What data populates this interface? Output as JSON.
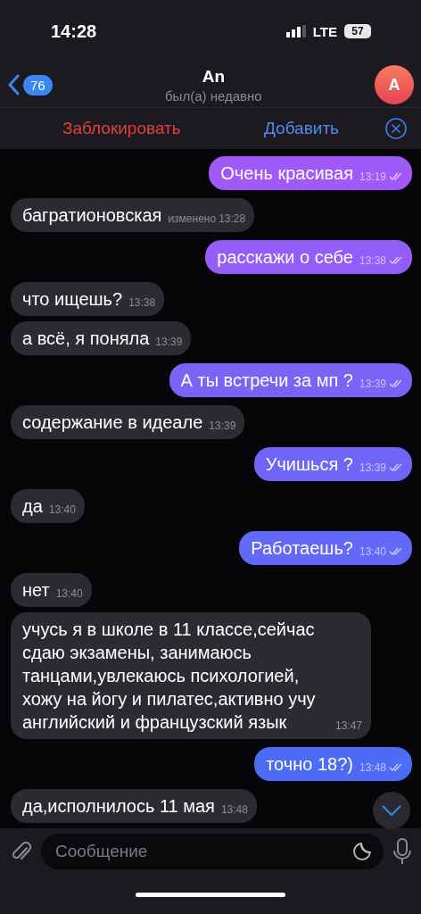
{
  "status_bar": {
    "time": "14:28",
    "network": "LTE",
    "battery": "57"
  },
  "header": {
    "back_count": "76",
    "title": "An",
    "subtitle": "был(а) недавно",
    "avatar": "A"
  },
  "action_bar": {
    "block": "Заблокировать",
    "add": "Добавить"
  },
  "messages": [
    {
      "kind": "outgoing",
      "text": "Очень красивая",
      "time": "13:19",
      "read": true
    },
    {
      "kind": "incoming",
      "text": "багратионовская",
      "time": "13:28",
      "edited": "изменено"
    },
    {
      "kind": "outgoing",
      "text": "расскажи о себе",
      "time": "13:38",
      "read": true
    },
    {
      "kind": "incoming",
      "text": "что ищешь?",
      "time": "13:38"
    },
    {
      "kind": "incoming",
      "text": "а всё, я поняла",
      "time": "13:39"
    },
    {
      "kind": "outgoing",
      "text": "А ты встречи за мп ?",
      "time": "13:39",
      "read": true
    },
    {
      "kind": "incoming",
      "text": "содержание в идеале",
      "time": "13:39"
    },
    {
      "kind": "outgoing",
      "text": "Учишься ?",
      "time": "13:39",
      "read": true
    },
    {
      "kind": "incoming",
      "text": "да",
      "time": "13:40"
    },
    {
      "kind": "outgoing",
      "text": "Работаешь?",
      "time": "13:40",
      "read": true
    },
    {
      "kind": "incoming",
      "text": "нет",
      "time": "13:40"
    },
    {
      "kind": "incoming",
      "text": "учусь я в школе в 11 классе,сейчас сдаю экзамены, занимаюсь танцами,увлекаюсь психологией, хожу на йогу и пилатес,активно учу английский и французский язык",
      "time": "13:47"
    },
    {
      "kind": "outgoing",
      "text": "точно 18?)",
      "time": "13:48",
      "read": true
    },
    {
      "kind": "incoming",
      "text": "да,исполнилось 11 мая",
      "time": "13:48"
    }
  ],
  "composer": {
    "placeholder": "Сообщение"
  }
}
